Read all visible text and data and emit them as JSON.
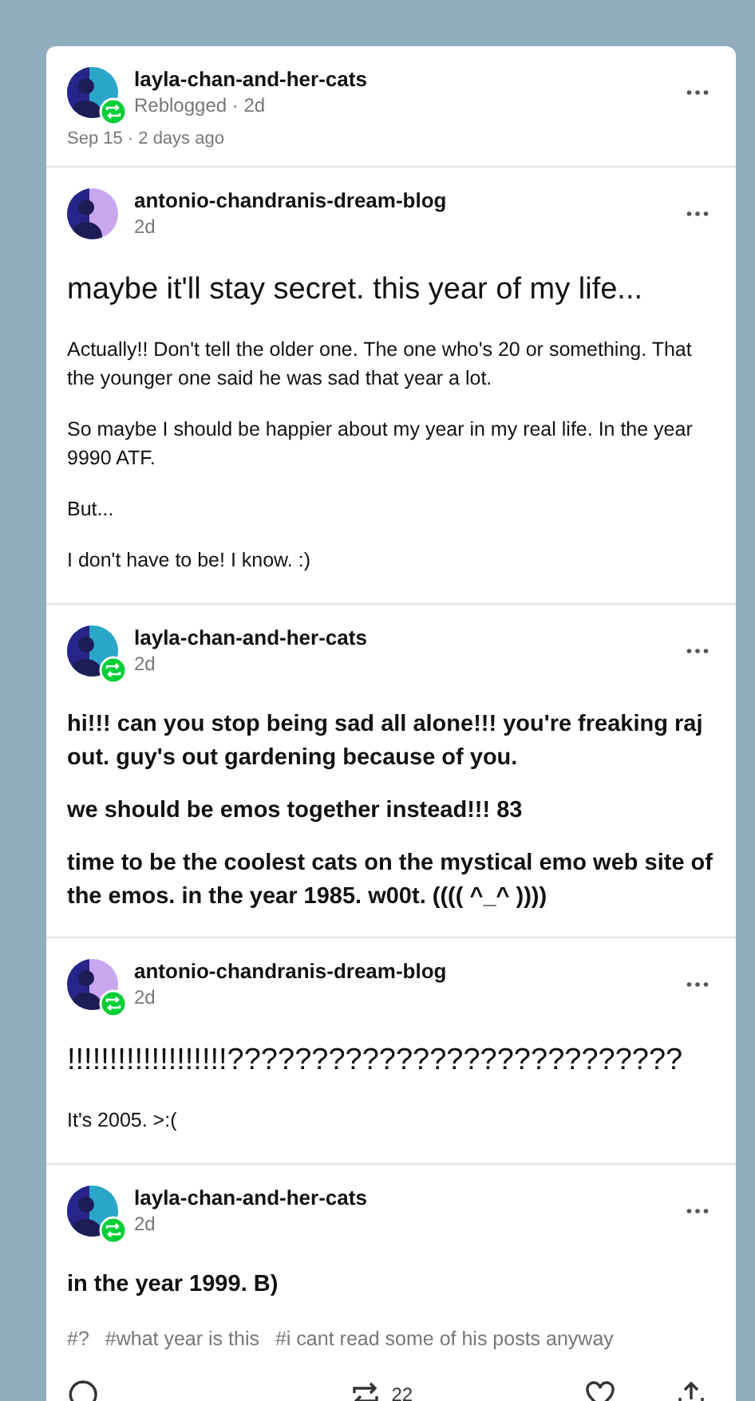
{
  "header": {
    "blog": "layla-chan-and-her-cats",
    "meta": "Reblogged · 2d",
    "date": "Sep 15 · 2 days ago",
    "reblogged": true,
    "color": "#2aa6c8"
  },
  "posts": [
    {
      "blog": "antonio-chandranis-dream-blog",
      "time": "2d",
      "reblogged": false,
      "color": "#c9a7ef",
      "paragraphs": [
        {
          "kind": "title",
          "text": "maybe it'll stay secret. this year of my life..."
        },
        {
          "kind": "body",
          "text": "Actually!! Don't tell the older one. The one who's 20 or something. That the younger one said he was sad that year a lot."
        },
        {
          "kind": "body",
          "text": "So maybe I should be happier about my year in my real life. In the year 9990 ATF."
        },
        {
          "kind": "body",
          "text": "But..."
        },
        {
          "kind": "body",
          "text": "I don't have to be! I know. :)"
        }
      ]
    },
    {
      "blog": "layla-chan-and-her-cats",
      "time": "2d",
      "reblogged": true,
      "color": "#2aa6c8",
      "paragraphs": [
        {
          "kind": "bold",
          "text": "hi!!! can you stop being sad all alone!!! you're freaking raj out. guy's out gardening because of you."
        },
        {
          "kind": "bold",
          "text": "we should be emos together instead!!! 83"
        },
        {
          "kind": "bold",
          "text": "time to be the coolest cats on the mystical emo web site of the emos. in the year 1985. w00t. (((( ^_^ ))))"
        }
      ]
    },
    {
      "blog": "antonio-chandranis-dream-blog",
      "time": "2d",
      "reblogged": true,
      "color": "#c9a7ef",
      "paragraphs": [
        {
          "kind": "title",
          "text": "!!!!!!!!!!!!!!!!!!!???????????????????????????"
        },
        {
          "kind": "body",
          "text": "It's 2005. >:("
        }
      ]
    },
    {
      "blog": "layla-chan-and-her-cats",
      "time": "2d",
      "reblogged": true,
      "color": "#2aa6c8",
      "paragraphs": [
        {
          "kind": "bold",
          "text": "in the year 1999. B)"
        }
      ]
    }
  ],
  "tags": [
    "#?",
    "#what year is this",
    "#i cant read some of his posts anyway"
  ],
  "actions": {
    "reblog_count": "22"
  }
}
